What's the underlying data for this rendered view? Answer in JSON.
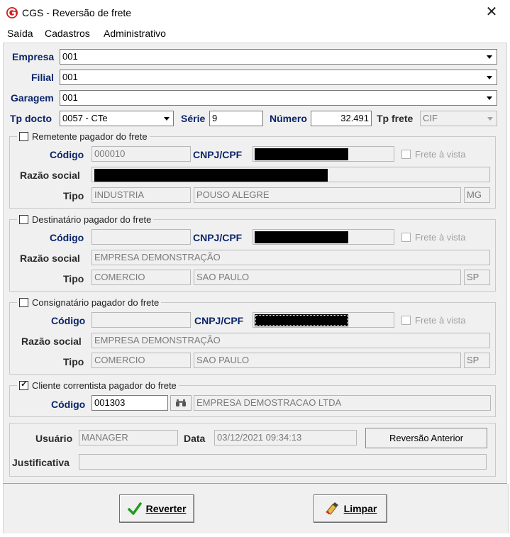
{
  "window": {
    "title": "CGS - Reversão de frete",
    "close_icon": "close-icon"
  },
  "menu": [
    "Saída",
    "Cadastros",
    "Administrativo"
  ],
  "header": {
    "empresa_label": "Empresa",
    "empresa_value": "001",
    "filial_label": "Filial",
    "filial_value": "001",
    "garagem_label": "Garagem",
    "garagem_value": "001",
    "tp_docto_label": "Tp docto",
    "tp_docto_value": "0057 - CTe",
    "serie_label": "Série",
    "serie_value": "9",
    "numero_label": "Número",
    "numero_value": "32.491",
    "tp_frete_label": "Tp frete",
    "tp_frete_value": "CIF"
  },
  "remetente": {
    "legend": "Remetente pagador do frete",
    "checked": false,
    "codigo_label": "Código",
    "codigo_value": "000010",
    "cnpj_label": "CNPJ/CPF",
    "frete_label": "Frete à vista",
    "razao_label": "Razão social",
    "tipo_label": "Tipo",
    "tipo_value": "INDUSTRIA",
    "cidade_value": "POUSO ALEGRE",
    "uf_value": "MG"
  },
  "destinatario": {
    "legend": "Destinatário pagador do frete",
    "checked": false,
    "codigo_label": "Código",
    "codigo_value": "",
    "cnpj_label": "CNPJ/CPF",
    "frete_label": "Frete à vista",
    "razao_label": "Razão social",
    "razao_value": "EMPRESA DEMONSTRAÇÃO",
    "tipo_label": "Tipo",
    "tipo_value": "COMERCIO",
    "cidade_value": "SAO PAULO",
    "uf_value": "SP"
  },
  "consignatario": {
    "legend": "Consignatário pagador do frete",
    "checked": false,
    "codigo_label": "Código",
    "codigo_value": "",
    "cnpj_label": "CNPJ/CPF",
    "frete_label": "Frete à vista",
    "razao_label": "Razão social",
    "razao_value": "EMPRESA DEMONSTRAÇÃO",
    "tipo_label": "Tipo",
    "tipo_value": "COMERCIO",
    "cidade_value": "SAO PAULO",
    "uf_value": "SP"
  },
  "cliente": {
    "legend": "Cliente correntista pagador do frete",
    "checked": true,
    "codigo_label": "Código",
    "codigo_value": "001303",
    "search_icon": "binoculars-icon",
    "nome_value": "EMPRESA DEMOSTRACAO LTDA"
  },
  "footer_info": {
    "usuario_label": "Usuário",
    "usuario_value": "MANAGER",
    "data_label": "Data",
    "data_value": "03/12/2021 09:34:13",
    "reversao_button": "Reversão Anterior",
    "justificativa_label": "Justificativa",
    "justificativa_value": ""
  },
  "actions": {
    "reverter_label": "Reverter",
    "reverter_icon": "checkmark-icon",
    "limpar_label": "Limpar",
    "limpar_icon": "eraser-icon"
  },
  "colors": {
    "label_blue": "#0a246a",
    "check_green": "#1f9b1f",
    "app_red": "#d11f1f"
  }
}
